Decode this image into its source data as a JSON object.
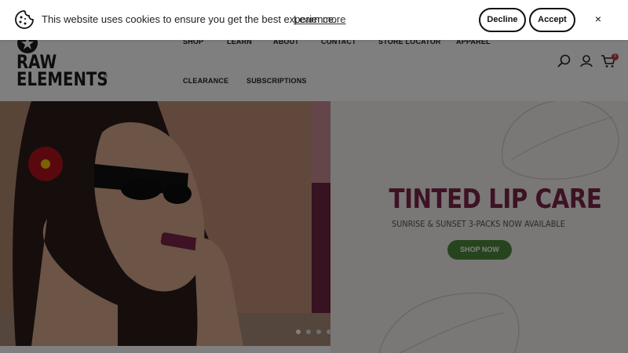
{
  "cookie_banner": {
    "message": "This website uses cookies to ensure you get the best experience.",
    "learn_more": "Learn more",
    "decline_label": "Decline",
    "accept_label": "Accept",
    "close_label": "×",
    "icon": "cookie-icon"
  },
  "header": {
    "logo_line1": "RAW",
    "logo_line2": "ELEMENTS",
    "logo_tm": "®",
    "nav": [
      "SHOP",
      "LEARN",
      "ABOUT",
      "CONTACT",
      "STORE LOCATOR",
      "APPAREL",
      "CLEARANCE",
      "SUBSCRIPTIONS"
    ],
    "icons": [
      "search-icon",
      "account-icon",
      "cart-icon"
    ],
    "cart_count": "0"
  },
  "hero": {
    "title": "TINTED LIP CARE",
    "subtitle": "SUNRISE & SUNSET 3-PACKS NOW AVAILABLE",
    "cta_label": "SHOP NOW",
    "slide_count": 4,
    "active_slide": 1
  },
  "colors": {
    "title": "#7b2548",
    "cta": "#4c8a3c",
    "overlay": "rgba(0,0,0,0.5)"
  }
}
